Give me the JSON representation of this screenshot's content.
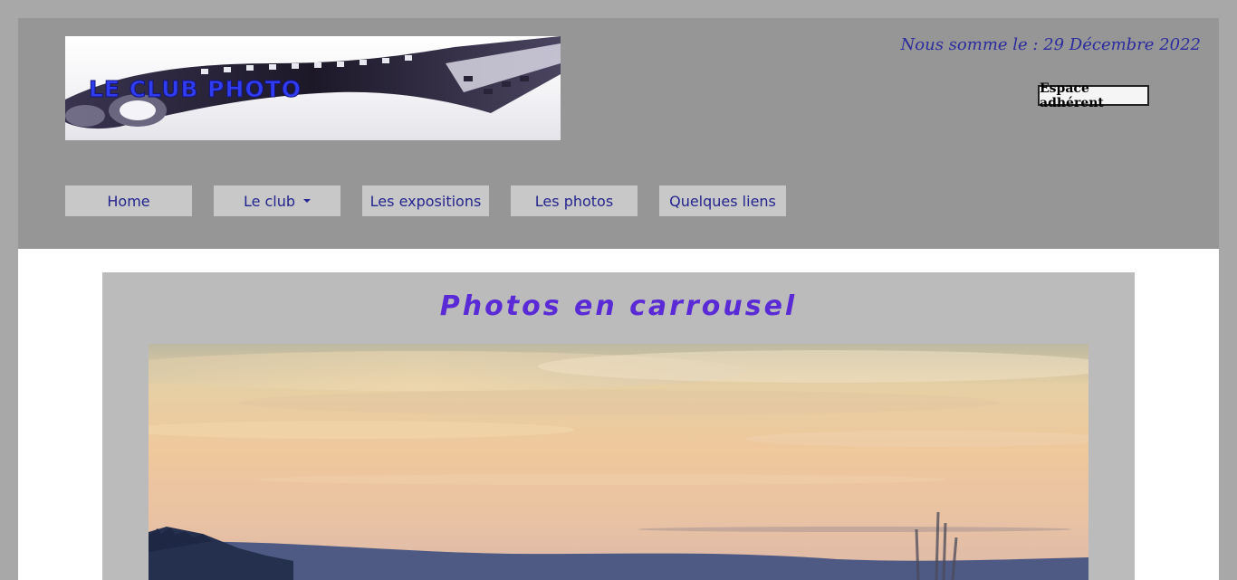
{
  "header": {
    "logo_text": "LE CLUB PHOTO",
    "date_text": "Nous somme le : 29 Décembre 2022",
    "member_button_label": "Espace adhérent"
  },
  "nav": {
    "items": [
      {
        "label": "Home"
      },
      {
        "label": "Le club",
        "has_dropdown": true
      },
      {
        "label": "Les expositions"
      },
      {
        "label": "Les photos"
      },
      {
        "label": "Quelques liens"
      }
    ]
  },
  "main": {
    "title": "Photos en carrousel"
  },
  "colors": {
    "page_bg": "#a8a8a8",
    "header_bg": "#969696",
    "nav_button_bg": "#c8c8c8",
    "nav_text": "#24248e",
    "title": "#5a2ad6",
    "panel_bg": "#bbbbbb"
  }
}
